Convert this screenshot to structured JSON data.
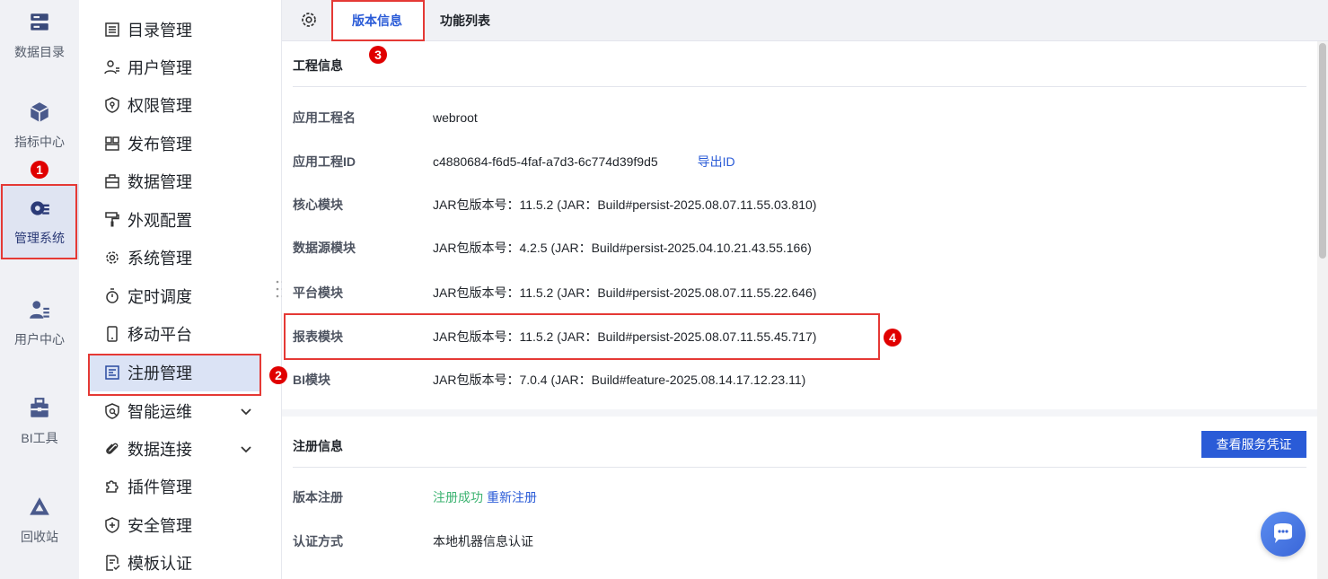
{
  "rail": {
    "items": [
      {
        "label": "数据目录",
        "icon": "database-icon"
      },
      {
        "label": "指标中心",
        "icon": "cube-icon"
      },
      {
        "label": "管理系统",
        "icon": "gear-list-icon"
      },
      {
        "label": "用户中心",
        "icon": "user-list-icon"
      },
      {
        "label": "BI工具",
        "icon": "toolbox-icon"
      },
      {
        "label": "回收站",
        "icon": "recycle-icon"
      }
    ]
  },
  "menu": {
    "items": [
      {
        "label": "目录管理",
        "icon": "list-icon"
      },
      {
        "label": "用户管理",
        "icon": "user-icon"
      },
      {
        "label": "权限管理",
        "icon": "shield-lock-icon"
      },
      {
        "label": "发布管理",
        "icon": "layout-icon"
      },
      {
        "label": "数据管理",
        "icon": "briefcase-icon"
      },
      {
        "label": "外观配置",
        "icon": "paint-roller-icon"
      },
      {
        "label": "系统管理",
        "icon": "gear-icon"
      },
      {
        "label": "定时调度",
        "icon": "stopwatch-icon"
      },
      {
        "label": "移动平台",
        "icon": "mobile-icon"
      },
      {
        "label": "注册管理",
        "icon": "register-icon"
      },
      {
        "label": "智能运维",
        "icon": "ops-icon"
      },
      {
        "label": "数据连接",
        "icon": "paperclip-icon"
      },
      {
        "label": "插件管理",
        "icon": "puzzle-icon"
      },
      {
        "label": "安全管理",
        "icon": "shield-plus-icon"
      },
      {
        "label": "模板认证",
        "icon": "template-icon"
      }
    ]
  },
  "tabs": [
    {
      "label": "版本信息"
    },
    {
      "label": "功能列表"
    }
  ],
  "project": {
    "title": "工程信息",
    "rows": [
      {
        "key": "应用工程名",
        "value": "webroot"
      },
      {
        "key": "应用工程ID",
        "value": "c4880684-f6d5-4faf-a7d3-6c774d39f9d5",
        "link": "导出ID"
      },
      {
        "key": "核心模块",
        "value": "JAR包版本号：11.5.2 (JAR：Build#persist-2025.08.07.11.55.03.810)"
      },
      {
        "key": "数据源模块",
        "value": "JAR包版本号：4.2.5 (JAR：Build#persist-2025.04.10.21.43.55.166)"
      },
      {
        "key": "平台模块",
        "value": "JAR包版本号：11.5.2 (JAR：Build#persist-2025.08.07.11.55.22.646)"
      },
      {
        "key": "报表模块",
        "value": "JAR包版本号：11.5.2 (JAR：Build#persist-2025.08.07.11.55.45.717)"
      },
      {
        "key": "BI模块",
        "value": "JAR包版本号：7.0.4 (JAR：Build#feature-2025.08.14.17.12.23.11)"
      }
    ]
  },
  "registration": {
    "title": "注册信息",
    "button": "查看服务凭证",
    "rows": [
      {
        "key": "版本注册",
        "value": "注册成功",
        "link": "重新注册"
      },
      {
        "key": "认证方式",
        "value": "本地机器信息认证"
      }
    ]
  },
  "badges": [
    "1",
    "2",
    "3",
    "4"
  ],
  "colors": {
    "accent": "#2a5bd7",
    "highlight": "#e53935",
    "badge": "#e00000",
    "success": "#3cb371"
  }
}
